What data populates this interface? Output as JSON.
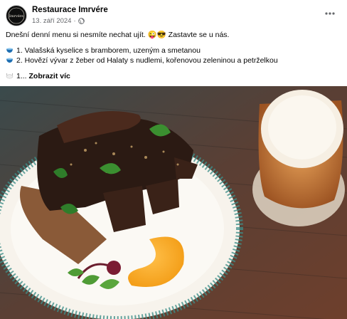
{
  "post": {
    "page_name": "Restaurace Imrvére",
    "avatar_text": "Imrvére",
    "date": "13. září 2024",
    "separator": "·",
    "text_line1": "Dnešní denní menu si nesmíte nechat ujít. 😜😎 Zastavte se u nás.",
    "menu_items": [
      "1. Valašská kyselice s bramborem, uzeným a smetanou",
      "2. Hovězí vývar z žeber od Halaty s nudlemi, kořenovou zeleninou a petrželkou"
    ],
    "truncated_prefix": "1...",
    "see_more": "Zobrazit víc"
  },
  "icons": {
    "more": "more-horizontal-icon",
    "audience": "globe-icon",
    "bowl": "bowl-emoji-icon",
    "plate": "plate-emoji-icon"
  },
  "colors": {
    "meta_text": "#65676b",
    "primary_text": "#050505",
    "bowl_emoji": "#1f6fb2"
  }
}
